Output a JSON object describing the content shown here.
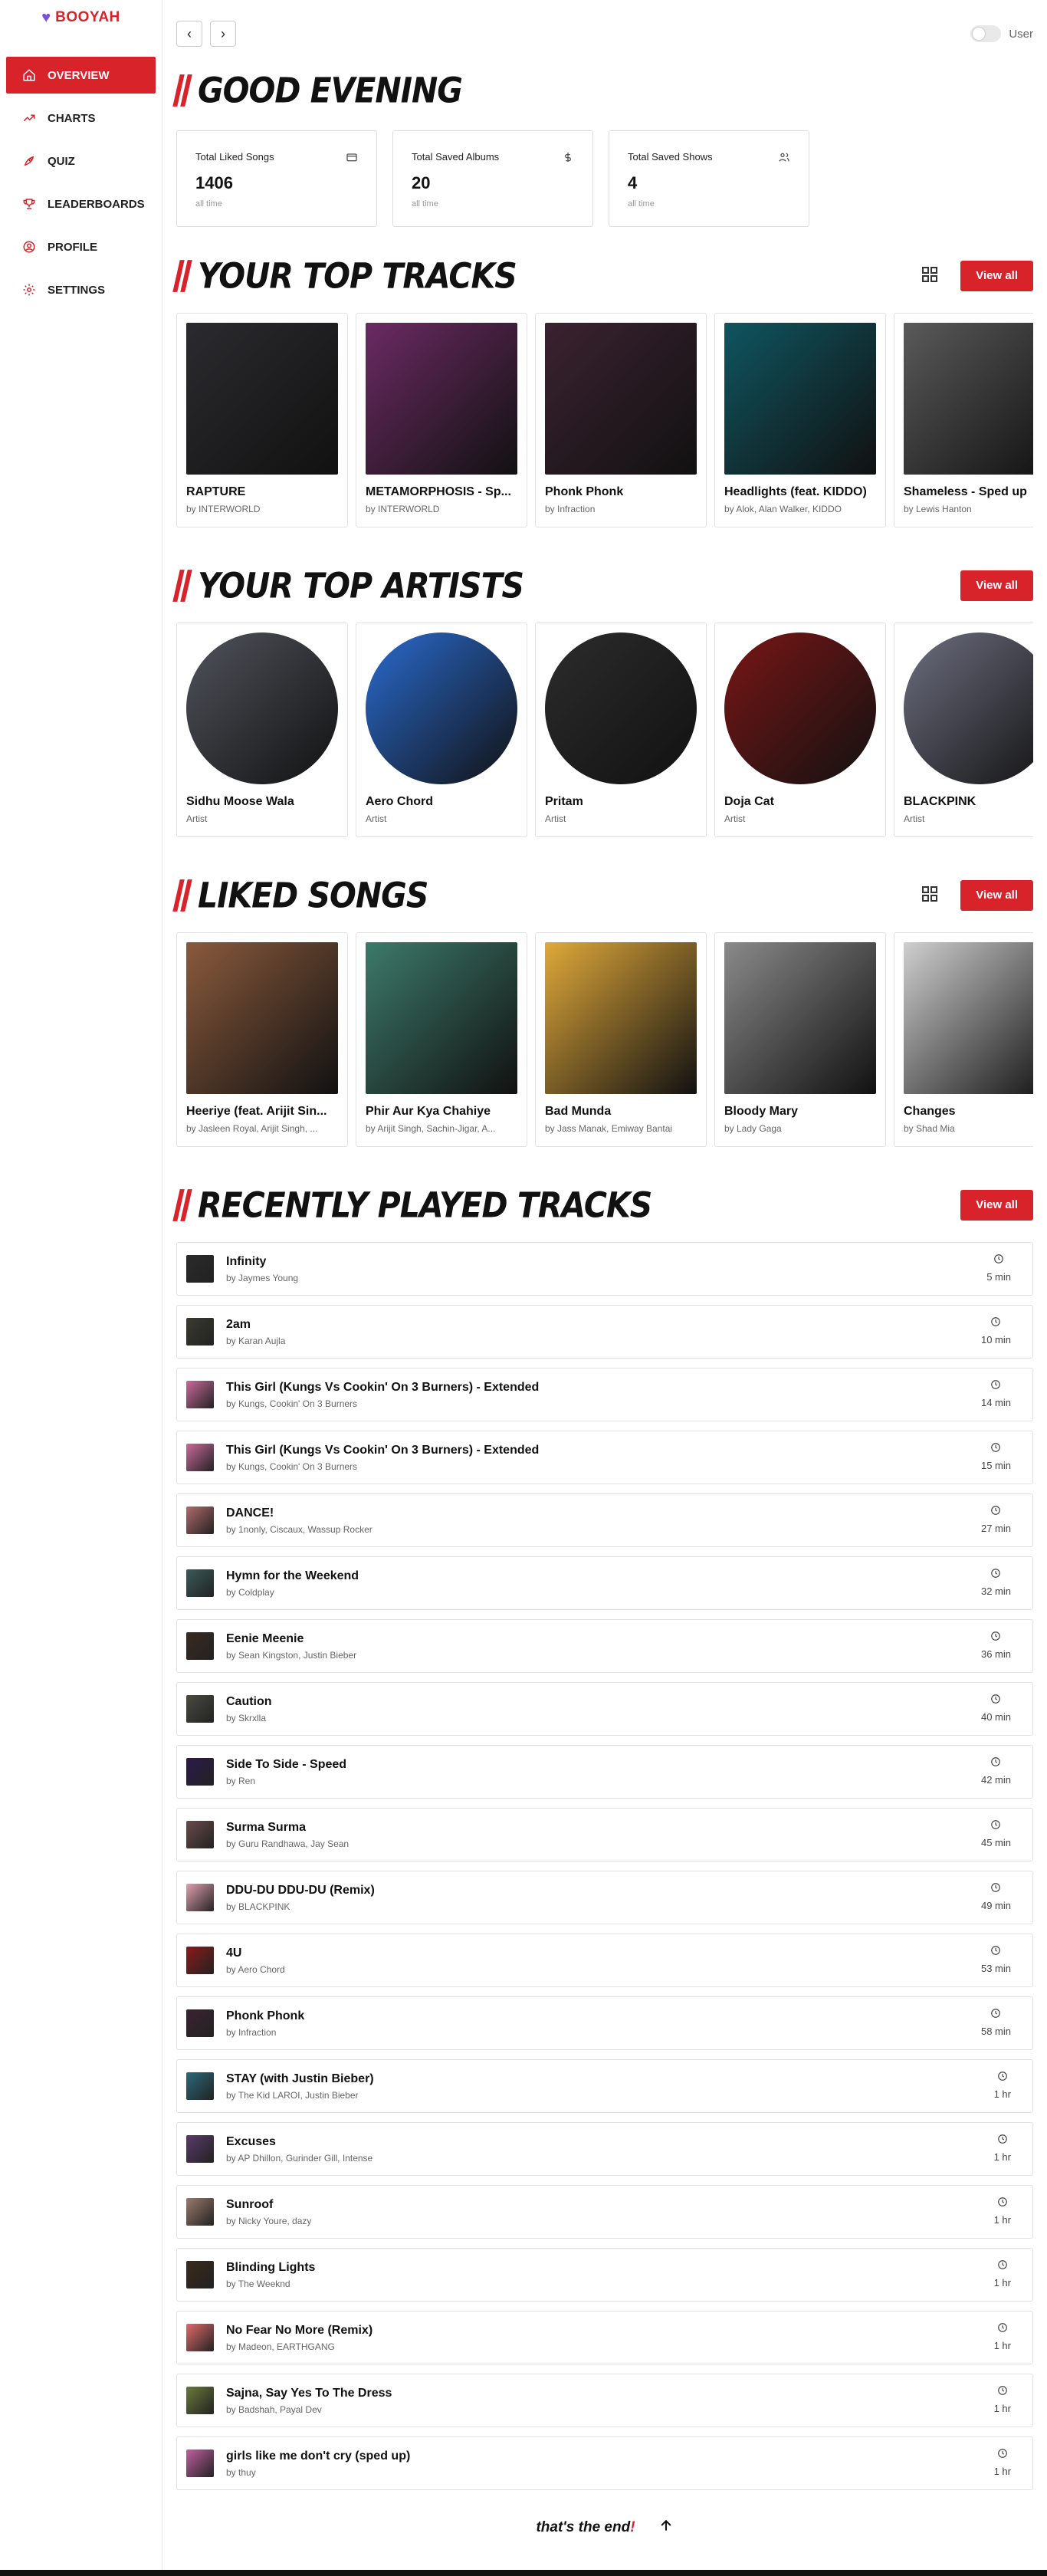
{
  "brand": {
    "name": "BOOYAH",
    "heart_color": "#7b4fd6",
    "accent": "#d8232a"
  },
  "nav": [
    {
      "label": "OVERVIEW",
      "icon": "home-icon",
      "active": true
    },
    {
      "label": "CHARTS",
      "icon": "trend-icon",
      "active": false
    },
    {
      "label": "QUIZ",
      "icon": "rocket-icon",
      "active": false
    },
    {
      "label": "LEADERBOARDS",
      "icon": "trophy-icon",
      "active": false
    },
    {
      "label": "PROFILE",
      "icon": "user-circle-icon",
      "active": false
    },
    {
      "label": "SETTINGS",
      "icon": "gear-icon",
      "active": false
    }
  ],
  "topbar": {
    "back": "‹",
    "forward": "›",
    "user_label": "User"
  },
  "greeting": "GOOD EVENING",
  "stats": [
    {
      "label": "Total Liked Songs",
      "value": "1406",
      "sub": "all time",
      "icon": "card-icon"
    },
    {
      "label": "Total Saved Albums",
      "value": "20",
      "sub": "all time",
      "icon": "dollar-icon"
    },
    {
      "label": "Total Saved Shows",
      "value": "4",
      "sub": "all time",
      "icon": "users-icon"
    }
  ],
  "view_all": "View all",
  "top_tracks": {
    "title": "YOUR TOP TRACKS",
    "items": [
      {
        "title": "RAPTURE",
        "sub": "by INTERWORLD",
        "color": "#2b2b2f"
      },
      {
        "title": "METAMORPHOSIS - Sp...",
        "sub": "by INTERWORLD",
        "color": "#6b2a63"
      },
      {
        "title": "Phonk Phonk",
        "sub": "by Infraction",
        "color": "#3b2230"
      },
      {
        "title": "Headlights (feat. KIDDO)",
        "sub": "by Alok, Alan Walker, KIDDO",
        "color": "#0f5560"
      },
      {
        "title": "Shameless - Sped up",
        "sub": "by Lewis Hanton",
        "color": "#5a5a5a"
      }
    ]
  },
  "top_artists": {
    "title": "YOUR TOP ARTISTS",
    "items": [
      {
        "title": "Sidhu Moose Wala",
        "sub": "Artist",
        "color": "#50535c"
      },
      {
        "title": "Aero Chord",
        "sub": "Artist",
        "color": "#2a6bd0"
      },
      {
        "title": "Pritam",
        "sub": "Artist",
        "color": "#2c2c2c"
      },
      {
        "title": "Doja Cat",
        "sub": "Artist",
        "color": "#7a1616"
      },
      {
        "title": "BLACKPINK",
        "sub": "Artist",
        "color": "#6d6f80"
      }
    ]
  },
  "liked_songs": {
    "title": "LIKED SONGS",
    "items": [
      {
        "title": "Heeriye (feat. Arijit Sin...",
        "sub": "by Jasleen Royal, Arijit Singh, ...",
        "color": "#8a5a3c"
      },
      {
        "title": "Phir Aur Kya Chahiye",
        "sub": "by Arijit Singh, Sachin-Jigar, A...",
        "color": "#3c7a6a"
      },
      {
        "title": "Bad Munda",
        "sub": "by Jass Manak, Emiway Bantai",
        "color": "#e0a93a"
      },
      {
        "title": "Bloody Mary",
        "sub": "by Lady Gaga",
        "color": "#8a8a8a"
      },
      {
        "title": "Changes",
        "sub": "by Shad Mia",
        "color": "#cfcfcf"
      }
    ]
  },
  "recent": {
    "title": "RECENTLY PLAYED TRACKS",
    "items": [
      {
        "title": "Infinity",
        "sub": "by Jaymes Young",
        "time": "5 min",
        "color": "#2a2a2a"
      },
      {
        "title": "2am",
        "sub": "by Karan Aujla",
        "time": "10 min",
        "color": "#3a3a30"
      },
      {
        "title": "This Girl (Kungs Vs Cookin' On 3 Burners) - Extended",
        "sub": "by Kungs, Cookin' On 3 Burners",
        "time": "14 min",
        "color": "#c96a9a"
      },
      {
        "title": "This Girl (Kungs Vs Cookin' On 3 Burners) - Extended",
        "sub": "by Kungs, Cookin' On 3 Burners",
        "time": "15 min",
        "color": "#c96a9a"
      },
      {
        "title": "DANCE!",
        "sub": "by 1nonly, Ciscaux, Wassup Rocker",
        "time": "27 min",
        "color": "#b06a6a"
      },
      {
        "title": "Hymn for the Weekend",
        "sub": "by Coldplay",
        "time": "32 min",
        "color": "#3a5a5a"
      },
      {
        "title": "Eenie Meenie",
        "sub": "by Sean Kingston, Justin Bieber",
        "time": "36 min",
        "color": "#3a2a20"
      },
      {
        "title": "Caution",
        "sub": "by Skrxlla",
        "time": "40 min",
        "color": "#4a4a40"
      },
      {
        "title": "Side To Side - Speed",
        "sub": "by Ren",
        "time": "42 min",
        "color": "#2a1a4a"
      },
      {
        "title": "Surma Surma",
        "sub": "by Guru Randhawa, Jay Sean",
        "time": "45 min",
        "color": "#6a4a4a"
      },
      {
        "title": "DDU-DU DDU-DU (Remix)",
        "sub": "by BLACKPINK",
        "time": "49 min",
        "color": "#e0a0b0"
      },
      {
        "title": "4U",
        "sub": "by Aero Chord",
        "time": "53 min",
        "color": "#8a1a1a"
      },
      {
        "title": "Phonk Phonk",
        "sub": "by Infraction",
        "time": "58 min",
        "color": "#3b2230"
      },
      {
        "title": "STAY (with Justin Bieber)",
        "sub": "by The Kid LAROI, Justin Bieber",
        "time": "1 hr",
        "color": "#2a6a7a"
      },
      {
        "title": "Excuses",
        "sub": "by AP Dhillon, Gurinder Gill, Intense",
        "time": "1 hr",
        "color": "#5a3a6a"
      },
      {
        "title": "Sunroof",
        "sub": "by Nicky Youre, dazy",
        "time": "1 hr",
        "color": "#9a7a6a"
      },
      {
        "title": "Blinding Lights",
        "sub": "by The Weeknd",
        "time": "1 hr",
        "color": "#3a2a1a"
      },
      {
        "title": "No Fear No More (Remix)",
        "sub": "by Madeon, EARTHGANG",
        "time": "1 hr",
        "color": "#e06a6a"
      },
      {
        "title": "Sajna, Say Yes To The Dress",
        "sub": "by Badshah, Payal Dev",
        "time": "1 hr",
        "color": "#6a7a3a"
      },
      {
        "title": "girls like me don't cry (sped up)",
        "sub": "by thuy",
        "time": "1 hr",
        "color": "#c060a0"
      }
    ]
  },
  "footer": {
    "text": "that's the end",
    "excl": "!"
  }
}
